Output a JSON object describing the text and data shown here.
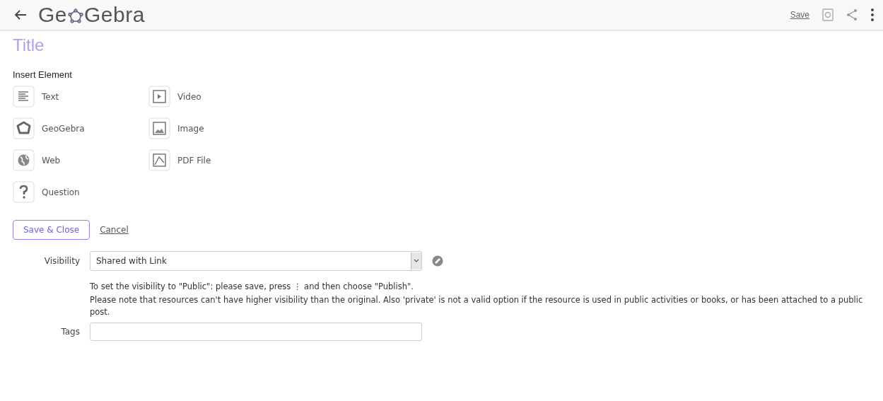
{
  "header": {
    "logo_before": "Ge",
    "logo_after": "Gebra",
    "save_link": "Save"
  },
  "title_placeholder": "Title",
  "insert": {
    "heading": "Insert Element",
    "items": [
      {
        "kind": "text",
        "label": "Text"
      },
      {
        "kind": "video",
        "label": "Video"
      },
      {
        "kind": "geogebra",
        "label": "GeoGebra"
      },
      {
        "kind": "image",
        "label": "Image"
      },
      {
        "kind": "web",
        "label": "Web"
      },
      {
        "kind": "pdf",
        "label": "PDF File"
      },
      {
        "kind": "question",
        "label": "Question"
      }
    ]
  },
  "actions": {
    "save_close": "Save & Close",
    "cancel": "Cancel"
  },
  "visibility": {
    "label": "Visibility",
    "value": "Shared with Link"
  },
  "notes": [
    "To set the visibility to \"Public\": please save, press ⋮ and then choose \"Publish\".",
    "Please note that resources can't have higher visibility than the original. Also 'private' is not a valid option if the resource is used in public activities or books, or has been attached to a public post."
  ],
  "tags": {
    "label": "Tags"
  }
}
